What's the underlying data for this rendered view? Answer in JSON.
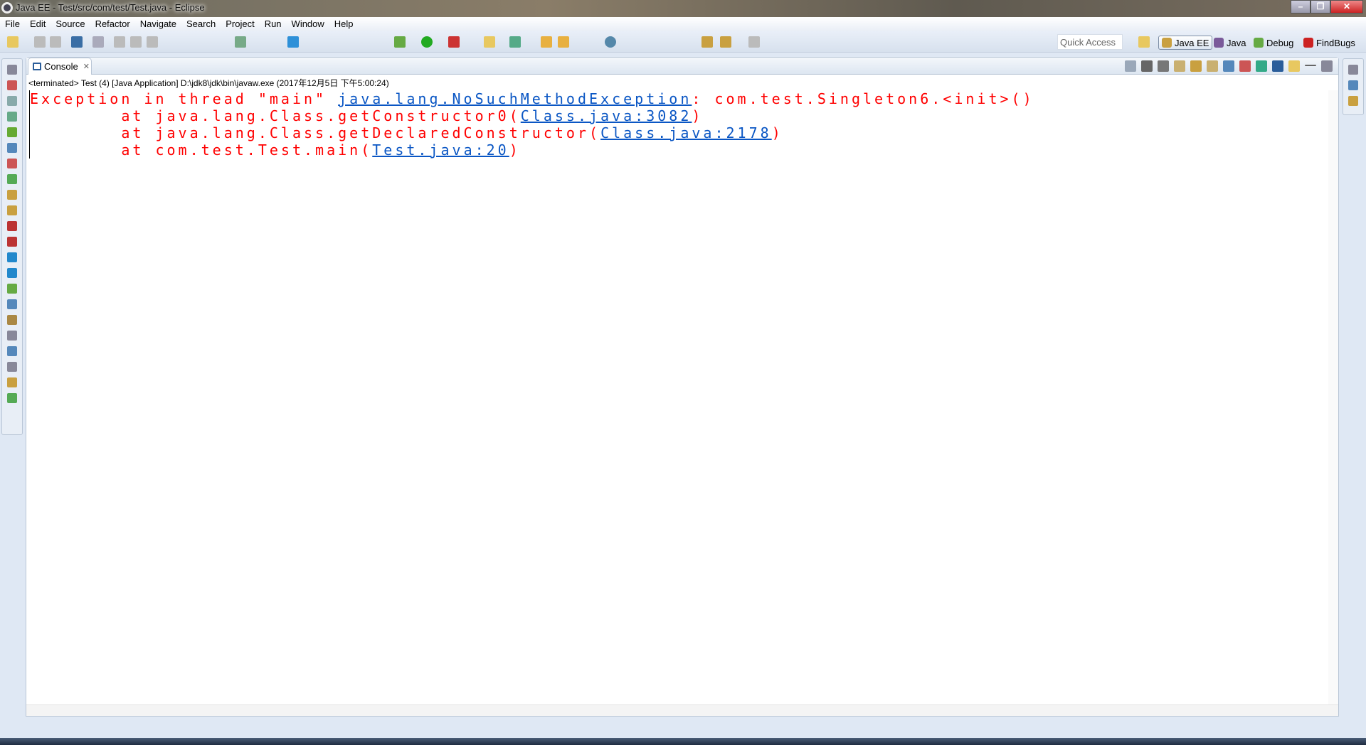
{
  "window": {
    "title": "Java EE - Test/src/com/test/Test.java - Eclipse"
  },
  "menu": [
    "File",
    "Edit",
    "Source",
    "Refactor",
    "Navigate",
    "Search",
    "Project",
    "Run",
    "Window",
    "Help"
  ],
  "toolbar": {
    "quick_access_placeholder": "Quick Access"
  },
  "perspectives": [
    {
      "label": "Java EE",
      "active": true
    },
    {
      "label": "Java"
    },
    {
      "label": "Debug"
    },
    {
      "label": "FindBugs"
    }
  ],
  "console": {
    "tab_label": "Console",
    "description": "<terminated> Test (4) [Java Application] D:\\jdk8\\jdk\\bin\\javaw.exe (2017年12月5日 下午5:00:24)",
    "line1_prefix": "Exception in thread \"main\" ",
    "line1_link": "java.lang.NoSuchMethodException",
    "line1_suffix": ": com.test.Singleton6.<init>()",
    "frames": [
      {
        "prefix": "        at java.lang.Class.getConstructor0(",
        "link": "Class.java:3082",
        "suffix": ")"
      },
      {
        "prefix": "        at java.lang.Class.getDeclaredConstructor(",
        "link": "Class.java:2178",
        "suffix": ")"
      },
      {
        "prefix": "        at com.test.Test.main(",
        "link": "Test.java:20",
        "suffix": ")"
      }
    ]
  },
  "colors": {
    "error": "#ff0000",
    "link": "#0a56c4"
  }
}
